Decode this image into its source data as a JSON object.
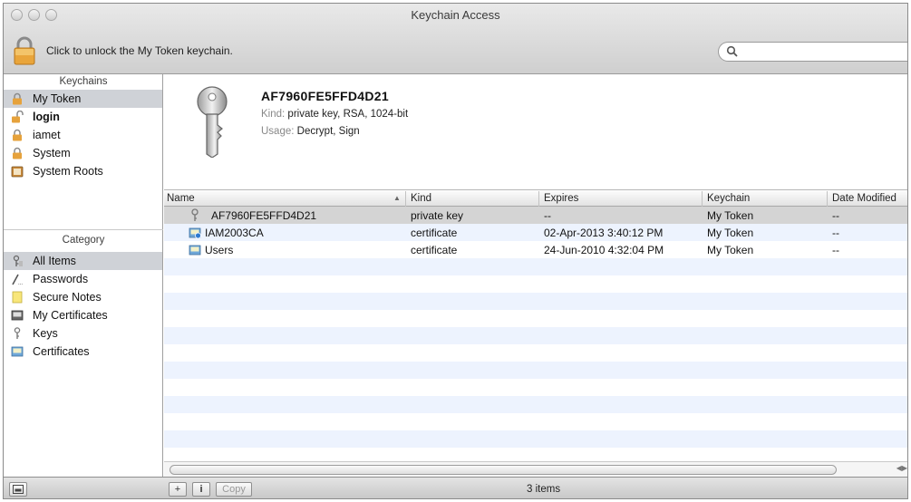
{
  "window": {
    "title": "Keychain Access"
  },
  "toolbar": {
    "unlock_message": "Click to unlock the My Token keychain.",
    "search_placeholder": ""
  },
  "sidebar": {
    "keychains_header": "Keychains",
    "keychains": [
      {
        "label": "My Token",
        "icon": "lock-icon",
        "selected": true,
        "bold": false
      },
      {
        "label": "login",
        "icon": "unlocked-lock-icon",
        "selected": false,
        "bold": true
      },
      {
        "label": "iamet",
        "icon": "lock-icon",
        "selected": false,
        "bold": false
      },
      {
        "label": "System",
        "icon": "lock-icon",
        "selected": false,
        "bold": false
      },
      {
        "label": "System Roots",
        "icon": "folder-lock-icon",
        "selected": false,
        "bold": false
      }
    ],
    "category_header": "Category",
    "categories": [
      {
        "label": "All Items",
        "icon": "all-items-icon",
        "selected": true
      },
      {
        "label": "Passwords",
        "icon": "password-icon",
        "selected": false
      },
      {
        "label": "Secure Notes",
        "icon": "secure-note-icon",
        "selected": false
      },
      {
        "label": "My Certificates",
        "icon": "my-certificate-icon",
        "selected": false
      },
      {
        "label": "Keys",
        "icon": "key-icon",
        "selected": false
      },
      {
        "label": "Certificates",
        "icon": "certificate-icon",
        "selected": false
      }
    ]
  },
  "detail": {
    "name": "AF7960FE5FFD4D21",
    "kind_label": "Kind:",
    "kind_value": "private key, RSA, 1024-bit",
    "usage_label": "Usage:",
    "usage_value": "Decrypt, Sign"
  },
  "table": {
    "columns": [
      "Name",
      "Kind",
      "Expires",
      "Keychain",
      "Date Modified"
    ],
    "sort_column": "Name",
    "rows": [
      {
        "name": "AF7960FE5FFD4D21",
        "icon": "key-icon",
        "kind": "private key",
        "expires": "--",
        "keychain": "My Token",
        "modified": "--",
        "selected": true
      },
      {
        "name": "IAM2003CA",
        "icon": "certificate-authority-icon",
        "kind": "certificate",
        "expires": "02-Apr-2013 3:40:12 PM",
        "keychain": "My Token",
        "modified": "--",
        "selected": false
      },
      {
        "name": "Users",
        "icon": "certificate-icon",
        "kind": "certificate",
        "expires": "24-Jun-2010 4:32:04 PM",
        "keychain": "My Token",
        "modified": "--",
        "selected": false
      }
    ]
  },
  "bottombar": {
    "add_label": "+",
    "info_label": "i",
    "copy_label": "Copy",
    "status": "3 items"
  },
  "colors": {
    "selection": "#cfd2d7",
    "alt_row": "#edf3fe",
    "selected_row": "#d4d4d4"
  }
}
